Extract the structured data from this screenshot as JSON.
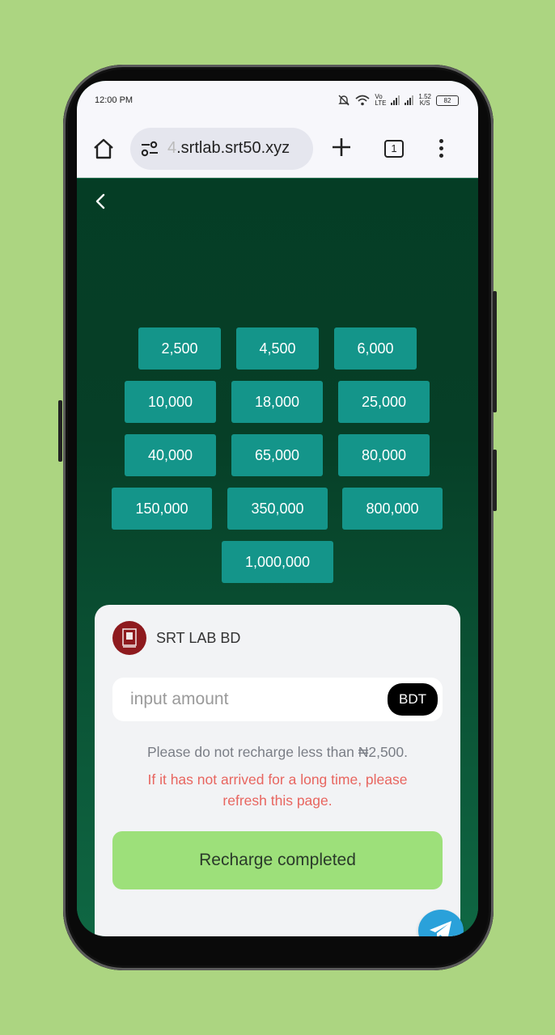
{
  "status": {
    "time": "12:00 PM",
    "net_label_top": "Vo",
    "net_label_bottom": "LTE",
    "speed_value": "1.52",
    "speed_unit": "K/S",
    "battery": "82"
  },
  "browser": {
    "url_faded": "4",
    "url": ".srtlab.srt50.xyz",
    "tab_count": "1"
  },
  "amounts": [
    "2,500",
    "4,500",
    "6,000",
    "10,000",
    "18,000",
    "25,000",
    "40,000",
    "65,000",
    "80,000",
    "150,000",
    "350,000",
    "800,000",
    "1,000,000"
  ],
  "card": {
    "brand_name": "SRT LAB BD",
    "amount_placeholder": "input amount",
    "currency": "BDT",
    "hint": "Please do not recharge less than ₦2,500.",
    "warning": "If it has not arrived for a long time, please refresh this page.",
    "submit_label": "Recharge completed"
  },
  "colors": {
    "background": "#acd581",
    "amount_button": "#14958a",
    "submit_button": "#9de07a",
    "warning_text": "#e8655f",
    "telegram": "#2aa1da"
  }
}
